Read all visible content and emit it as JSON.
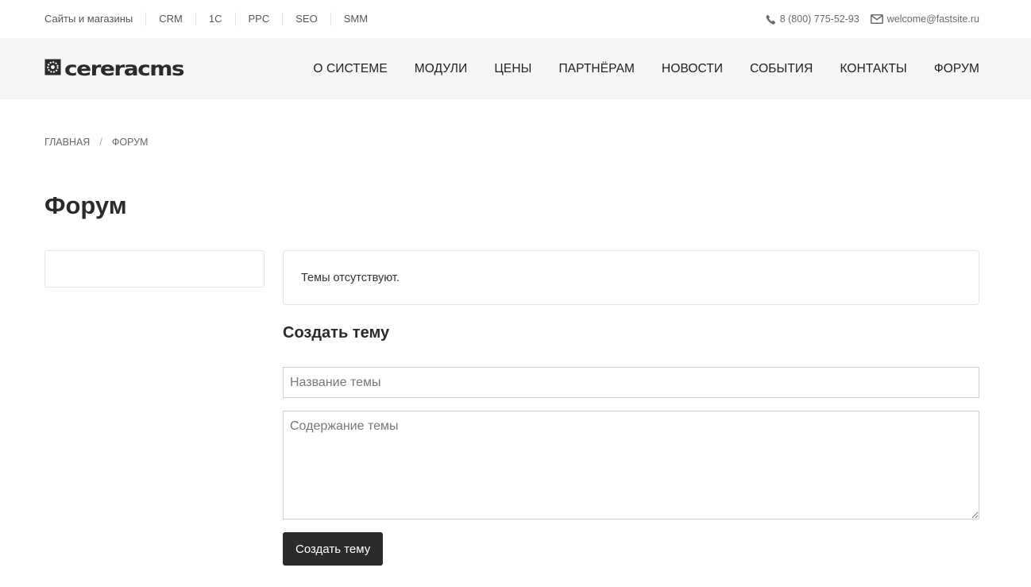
{
  "topbar": {
    "links": [
      "Сайты и магазины",
      "CRM",
      "1С",
      "PPC",
      "SEO",
      "SMM"
    ],
    "phone": "8 (800) 775-52-93",
    "email": "welcome@fastsite.ru"
  },
  "logo": {
    "text": "cereracms"
  },
  "nav": {
    "items": [
      "О СИСТЕМЕ",
      "МОДУЛИ",
      "ЦЕНЫ",
      "ПАРТНЁРАМ",
      "НОВОСТИ",
      "СОБЫТИЯ",
      "КОНТАКТЫ",
      "ФОРУМ"
    ]
  },
  "breadcrumb": {
    "home": "ГЛАВНАЯ",
    "separator": "/",
    "current": "ФОРУМ"
  },
  "page": {
    "title": "Форум"
  },
  "forum": {
    "empty_message": "Темы отсутствуют.",
    "create_title": "Создать тему",
    "topic_name_placeholder": "Название темы",
    "topic_body_placeholder": "Содержание темы",
    "submit_label": "Создать тему"
  },
  "colors": {
    "nav_bg": "#f4f5f7",
    "button_bg": "#2b2b2b"
  },
  "icons": {
    "phone": "phone-icon",
    "email": "envelope-icon",
    "logo": "gear-icon"
  }
}
